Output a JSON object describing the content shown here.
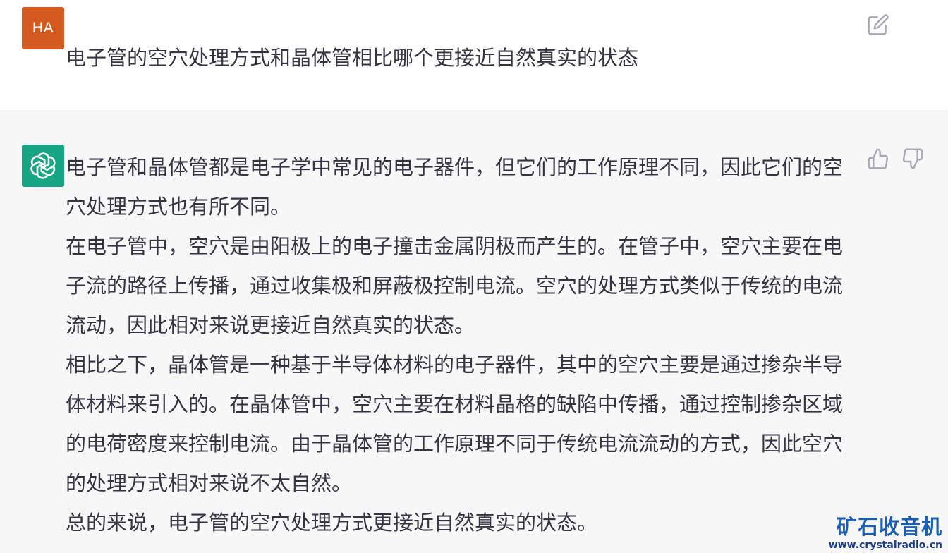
{
  "user_message": {
    "avatar_initials": "HA",
    "avatar_color": "#d45a1f",
    "text": "电子管的空穴处理方式和晶体管相比哪个更接近自然真实的状态",
    "edit_icon": "edit-icon"
  },
  "assistant_message": {
    "avatar_icon": "openai-logo-icon",
    "avatar_color": "#17a683",
    "paragraphs": [
      "电子管和晶体管都是电子学中常见的电子器件，但它们的工作原理不同，因此它们的空穴处理方式也有所不同。",
      "在电子管中，空穴是由阳极上的电子撞击金属阴极而产生的。在管子中，空穴主要在电子流的路径上传播，通过收集极和屏蔽极控制电流。空穴的处理方式类似于传统的电流流动，因此相对来说更接近自然真实的状态。",
      "相比之下，晶体管是一种基于半导体材料的电子器件，其中的空穴主要是通过掺杂半导体材料来引入的。在晶体管中，空穴主要在材料晶格的缺陷中传播，通过控制掺杂区域的电荷密度来控制电流。由于晶体管的工作原理不同于传统电流流动的方式，因此空穴的处理方式相对来说不太自然。",
      "总的来说，电子管的空穴处理方式更接近自然真实的状态。"
    ],
    "feedback_icons": [
      "thumbs-up-icon",
      "thumbs-down-icon"
    ]
  },
  "watermark": {
    "title": "矿石收音机",
    "url": "www.crystalradio.cn",
    "color": "#1b5fb4"
  }
}
